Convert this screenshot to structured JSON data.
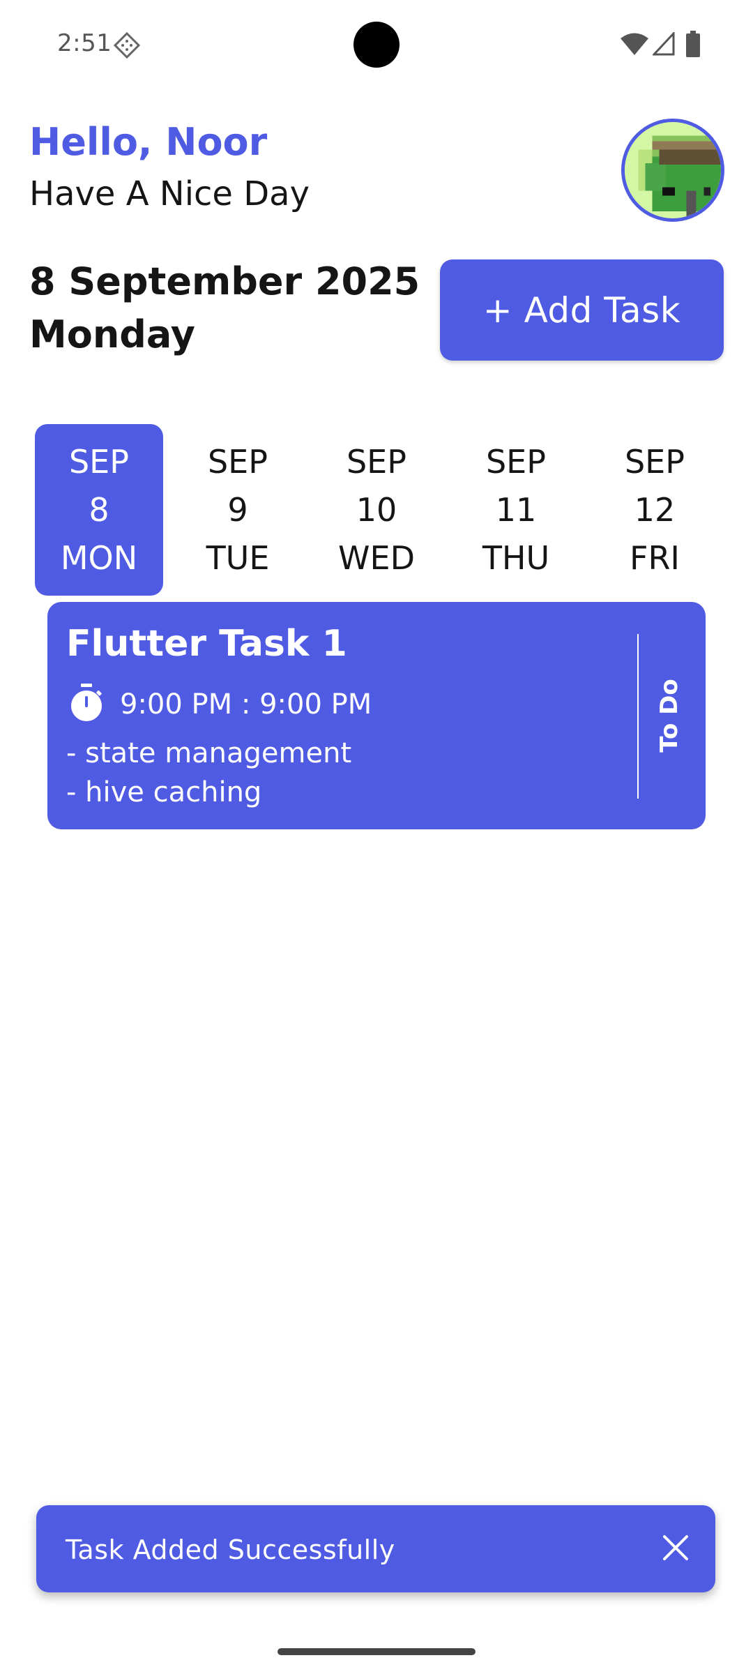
{
  "status_bar": {
    "time": "2:51",
    "icons": [
      "sim-icon",
      "wifi-icon",
      "signal-icon",
      "battery-icon"
    ]
  },
  "header": {
    "greeting": "Hello, Noor",
    "subgreeting": "Have A Nice Day",
    "avatar_icon": "pixel-avatar-icon"
  },
  "date_header": {
    "date": "8 September 2025",
    "weekday": "Monday"
  },
  "add_task_button": {
    "label": "+ Add Task"
  },
  "date_strip": [
    {
      "month": "SEP",
      "day": "8",
      "weekday": "MON",
      "selected": true
    },
    {
      "month": "SEP",
      "day": "9",
      "weekday": "TUE",
      "selected": false
    },
    {
      "month": "SEP",
      "day": "10",
      "weekday": "WED",
      "selected": false
    },
    {
      "month": "SEP",
      "day": "11",
      "weekday": "THU",
      "selected": false
    },
    {
      "month": "SEP",
      "day": "12",
      "weekday": "FRI",
      "selected": false
    }
  ],
  "tasks": [
    {
      "title": "Flutter Task 1",
      "time": "9:00 PM : 9:00 PM",
      "notes": [
        "- state management",
        "- hive caching"
      ],
      "status": "To Do",
      "icon": "timer-icon"
    }
  ],
  "snackbar": {
    "message": "Task Added Successfully",
    "close_icon": "close-icon"
  },
  "colors": {
    "accent": "#4f5be3",
    "text": "#151515",
    "background": "#ffffff"
  }
}
